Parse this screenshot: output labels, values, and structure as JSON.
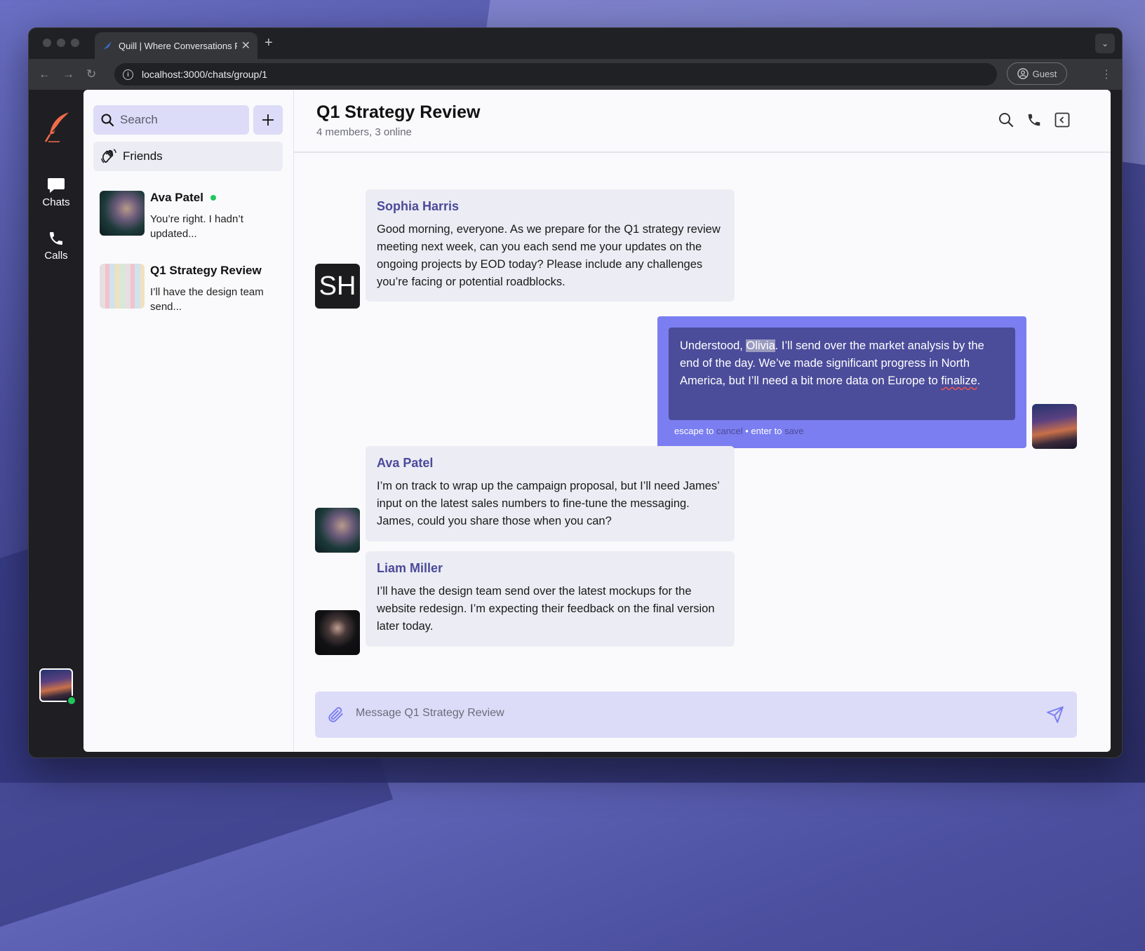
{
  "browser": {
    "tab_title": "Quill | Where Conversations F",
    "url": "localhost:3000/chats/group/1",
    "profile_label": "Guest"
  },
  "rail": {
    "items": [
      {
        "label": "Chats",
        "icon": "chat-bubble-icon"
      },
      {
        "label": "Calls",
        "icon": "phone-icon"
      }
    ],
    "logo_icon": "quill-feather-icon",
    "accent_color": "#f26b4b"
  },
  "sidebar": {
    "search_placeholder": "Search",
    "friends_label": "Friends",
    "conversations": [
      {
        "name": "Ava Patel",
        "online": true,
        "preview": "You’re right. I hadn’t updated..."
      },
      {
        "name": "Q1 Strategy Review",
        "online": false,
        "preview": "I’ll have the design team send..."
      }
    ]
  },
  "chat": {
    "title": "Q1 Strategy Review",
    "subtitle": "4 members, 3 online",
    "messages": [
      {
        "sender": "Sophia Harris",
        "initials": "SH",
        "text": "Good morning, everyone. As we prepare for the Q1 strategy review meeting next week, can you each send me your updates on the ongoing projects by EOD today? Please include any challenges you’re facing or potential roadblocks."
      },
      {
        "own": true,
        "text_before": "Understood, ",
        "highlight": "Olivia",
        "text_middle": ". I’ll send over the market analysis by the end of the day. We’ve made significant progress in North America, but I’ll need a bit more data on Europe to ",
        "misspelled": "finalize",
        "text_after": ".",
        "hint": {
          "escape": "escape to",
          "cancel": "cancel",
          "sep": "• enter to",
          "save": "save"
        }
      },
      {
        "sender": "Ava Patel",
        "text": "I’m on track to wrap up the campaign proposal, but I’ll need James’ input on the latest sales numbers to fine-tune the messaging. James, could you share those when you can?"
      },
      {
        "sender": "Liam Miller",
        "text": "I’ll have the design team send over the latest mockups for the website redesign. I’m expecting their feedback on the final version later today."
      }
    ],
    "composer_placeholder": "Message Q1 Strategy Review"
  },
  "colors": {
    "accent": "#7b7ef0",
    "own_bubble": "#4b4c9a",
    "input_bg": "#dcdcf8",
    "online": "#22c55e",
    "sender_name": "#4a4a9a"
  }
}
